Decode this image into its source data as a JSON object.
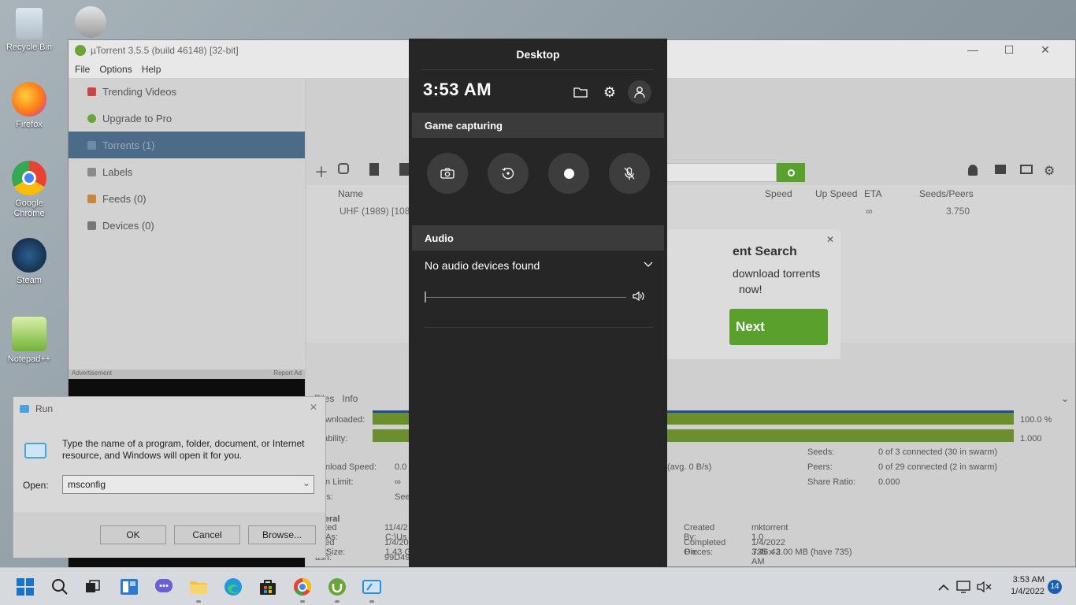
{
  "desktop": {
    "icons": [
      {
        "label": "Recycle Bin"
      },
      {
        "label": "Firefox"
      },
      {
        "label": "Google Chrome"
      },
      {
        "label": "Steam"
      },
      {
        "label": "Notepad++"
      }
    ]
  },
  "utorrent": {
    "title": "µTorrent 3.5.5  (build 46148) [32-bit]",
    "menu": [
      "File",
      "Options",
      "Help"
    ],
    "sidebar": [
      {
        "label": "Trending Videos"
      },
      {
        "label": "Upgrade to Pro"
      },
      {
        "label": "Torrents (1)"
      },
      {
        "label": "Labels"
      },
      {
        "label": "Feeds (0)"
      },
      {
        "label": "Devices (0)"
      }
    ],
    "ad_label": "Advertisement",
    "report_ad": "Report Ad",
    "columns": [
      "Name",
      "Speed",
      "Up Speed",
      "ETA",
      "Seeds/Peers"
    ],
    "row": {
      "name": "UHF (1989) [1080",
      "eta": "∞",
      "seeds": "3.750"
    },
    "popup": {
      "title": "ent Search",
      "line1": "download torrents",
      "line2": "now!",
      "next": "Next"
    },
    "tabs": [
      "Files",
      "Info"
    ],
    "downloaded_label": "Downloaded:",
    "downloaded_pct": "100.0 %",
    "availability_label": "ailability:",
    "availability_val": "1.000",
    "transfer": [
      {
        "label": "ownload Speed:",
        "val": "0.0"
      },
      {
        "label": "own Limit:",
        "val": "∞"
      },
      {
        "label": "atus:",
        "val": "See"
      }
    ],
    "transfer_right": [
      {
        "label": "Seeds:",
        "val": "0 of 3 connected (30 in swarm)"
      },
      {
        "label": "Peers:",
        "val": "0 of 29 connected (2 in swarm)"
      },
      {
        "label": "Share Ratio:",
        "val": "0.000"
      }
    ],
    "avg": "(avg. 0 B/s)",
    "general_label": "eneral",
    "general": [
      {
        "label": "ve As:",
        "val": "C:\\Us"
      },
      {
        "label": "tal Size:",
        "val": "1.43 G"
      },
      {
        "label": "eated On:",
        "val": "11/4/2"
      },
      {
        "label": "dded On:",
        "val": "1/4/20"
      },
      {
        "label": "ash:",
        "val": "99D49"
      }
    ],
    "general_right": [
      {
        "label": "Pieces:",
        "val": "735 x 2.00 MB (have 735)"
      },
      {
        "label": "Created By:",
        "val": "mktorrent 1.0"
      },
      {
        "label": "Completed On:",
        "val": "1/4/2022 3:46:43 AM"
      }
    ]
  },
  "run": {
    "title": "Run",
    "desc": "Type the name of a program, folder, document, or Internet resource, and Windows will open it for you.",
    "open_label": "Open:",
    "value": "msconfig",
    "ok": "OK",
    "cancel": "Cancel",
    "browse": "Browse..."
  },
  "gamebar": {
    "header": "Desktop",
    "time": "3:53 AM",
    "capture_title": "Game capturing",
    "audio_title": "Audio",
    "audio_device": "No audio devices found",
    "volume": 0
  },
  "taskbar": {
    "time": "3:53 AM",
    "date": "1/4/2022",
    "badge": "14"
  }
}
